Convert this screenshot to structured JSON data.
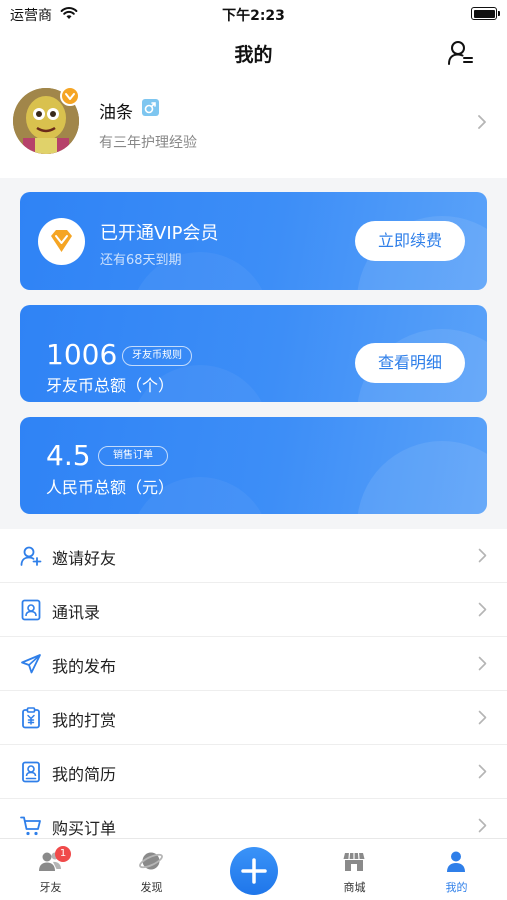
{
  "status_bar": {
    "carrier": "运营商",
    "time": "下午2:23"
  },
  "nav": {
    "title": "我的",
    "right_icon": "profile-menu-icon"
  },
  "profile": {
    "name": "油条",
    "bio": "有三年护理经验",
    "gender_icon": "male-icon"
  },
  "vip_card": {
    "title": "已开通VIP会员",
    "subtitle": "还有68天到期",
    "button": "立即续费"
  },
  "coin_card": {
    "amount": "1006",
    "tag": "牙友币规则",
    "label": "牙友币总额（个）",
    "button": "查看明细"
  },
  "rmb_card": {
    "amount": "4.5",
    "tag": "销售订单",
    "label": "人民币总额（元）"
  },
  "menu": [
    {
      "label": "邀请好友",
      "icon": "add-user-icon"
    },
    {
      "label": "通讯录",
      "icon": "contacts-icon"
    },
    {
      "label": "我的发布",
      "icon": "send-icon"
    },
    {
      "label": "我的打赏",
      "icon": "reward-icon"
    },
    {
      "label": "我的简历",
      "icon": "resume-icon"
    },
    {
      "label": "购买订单",
      "icon": "cart-icon"
    }
  ],
  "tabs": [
    {
      "label": "牙友",
      "icon": "friends-icon",
      "badge": "1"
    },
    {
      "label": "发现",
      "icon": "discover-icon"
    },
    {
      "label": "",
      "icon": "plus-icon"
    },
    {
      "label": "商城",
      "icon": "store-icon"
    },
    {
      "label": "我的",
      "icon": "me-icon",
      "active": true
    }
  ],
  "colors": {
    "accent": "#2f83f5",
    "badge": "#f04a4a",
    "vip_orange": "#f5a524"
  }
}
